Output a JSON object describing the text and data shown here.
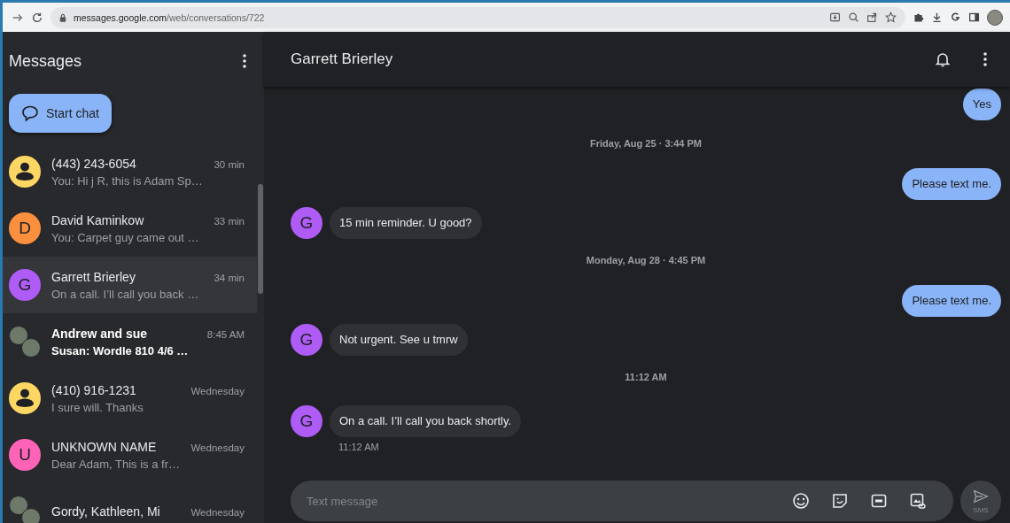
{
  "browser": {
    "url_host": "messages.google.com",
    "url_path": "/web/conversations/722"
  },
  "sidebar": {
    "title": "Messages",
    "start_chat": "Start chat",
    "conversations": [
      {
        "kind": "person",
        "color": "#fdd663",
        "name": "(443) 243-6054",
        "snippet": "You: Hi j R, this is Adam Sp…",
        "time": "30 min",
        "unread": false,
        "selected": false
      },
      {
        "kind": "letter",
        "color": "#fa903e",
        "initial": "D",
        "name": "David Kaminkow",
        "snippet": "You: Carpet guy came out …",
        "time": "33 min",
        "unread": false,
        "selected": false
      },
      {
        "kind": "letter",
        "color": "#af5cf7",
        "initial": "G",
        "name": "Garrett Brierley",
        "snippet": "On a call. I’ll call you back …",
        "time": "34 min",
        "unread": false,
        "selected": true
      },
      {
        "kind": "group",
        "color": "#6d7a6a",
        "name": "Andrew and sue",
        "snippet": "Susan: Wordle 810 4/6 …",
        "time": "8:45 AM",
        "unread": true,
        "selected": false
      },
      {
        "kind": "person",
        "color": "#fdd663",
        "name": "(410) 916-1231",
        "snippet": "I sure will. Thanks",
        "time": "Wednesday",
        "unread": false,
        "selected": false
      },
      {
        "kind": "letter",
        "color": "#ff63b8",
        "initial": "U",
        "name": "UNKNOWN NAME",
        "snippet": "Dear Adam, This is a fr…",
        "time": "Wednesday",
        "unread": false,
        "selected": false
      },
      {
        "kind": "group",
        "color": "#6d7a6a",
        "name": "Gordy, Kathleen, Mi",
        "time": "Wednesday",
        "unread": false,
        "selected": false
      }
    ]
  },
  "chat": {
    "title": "Garrett Brierley",
    "messages": [
      {
        "kind": "outgoing",
        "text": "Yes"
      },
      {
        "kind": "date",
        "text": "Friday, Aug 25 · 3:44 PM"
      },
      {
        "kind": "outgoing",
        "text": "Please text me."
      },
      {
        "kind": "incoming",
        "avatar": "G",
        "color": "#af5cf7",
        "text": "15 min reminder.  U good?"
      },
      {
        "kind": "date",
        "text": "Monday, Aug 28 · 4:45 PM"
      },
      {
        "kind": "outgoing",
        "text": "Please text me."
      },
      {
        "kind": "incoming",
        "avatar": "G",
        "color": "#af5cf7",
        "text": "Not urgent. See u tmrw"
      },
      {
        "kind": "date",
        "text": "11:12 AM"
      },
      {
        "kind": "incoming",
        "avatar": "G",
        "color": "#af5cf7",
        "text": "On a call.  I’ll call you back shortly.",
        "time": "11:12 AM"
      }
    ],
    "composer": {
      "placeholder": "Text message",
      "send_label": "SMS"
    }
  }
}
